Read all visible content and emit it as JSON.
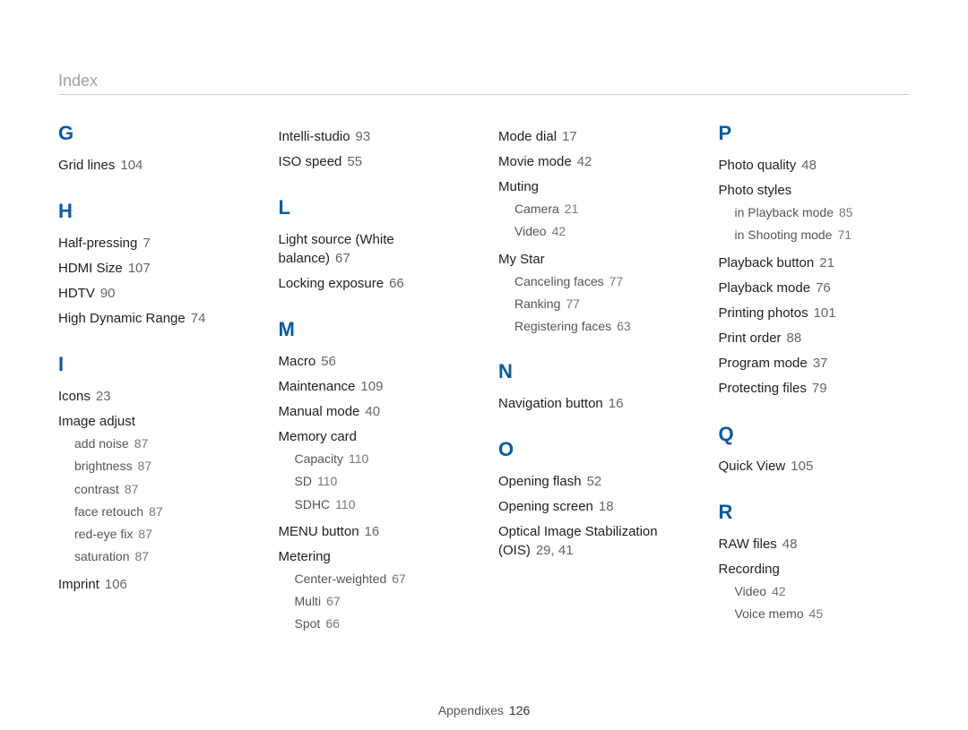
{
  "page_title": "Index",
  "footer": {
    "label": "Appendixes",
    "page": "126"
  },
  "col1": {
    "G": {
      "letter": "G",
      "items": [
        {
          "label": "Grid lines",
          "page": "104"
        }
      ]
    },
    "H": {
      "letter": "H",
      "items": [
        {
          "label": "Half-pressing",
          "page": "7"
        },
        {
          "label": "HDMI Size",
          "page": "107"
        },
        {
          "label": "HDTV",
          "page": "90"
        },
        {
          "label": "High Dynamic Range",
          "page": "74"
        }
      ]
    },
    "I": {
      "letter": "I",
      "icons": {
        "label": "Icons",
        "page": "23"
      },
      "image_adjust": {
        "label": "Image adjust",
        "subs": [
          {
            "label": "add noise",
            "page": "87"
          },
          {
            "label": "brightness",
            "page": "87"
          },
          {
            "label": "contrast",
            "page": "87"
          },
          {
            "label": "face retouch",
            "page": "87"
          },
          {
            "label": "red-eye fix",
            "page": "87"
          },
          {
            "label": "saturation",
            "page": "87"
          }
        ]
      },
      "imprint": {
        "label": "Imprint",
        "page": "106"
      }
    }
  },
  "col2": {
    "top": [
      {
        "label": "Intelli-studio",
        "page": "93"
      },
      {
        "label": "ISO speed",
        "page": "55"
      }
    ],
    "L": {
      "letter": "L",
      "items": [
        {
          "label": "Light source (White balance)",
          "page": "67"
        },
        {
          "label": "Locking exposure",
          "page": "66"
        }
      ]
    },
    "M": {
      "letter": "M",
      "items": [
        {
          "label": "Macro",
          "page": "56"
        },
        {
          "label": "Maintenance",
          "page": "109"
        },
        {
          "label": "Manual mode",
          "page": "40"
        }
      ],
      "memory": {
        "label": "Memory card",
        "subs": [
          {
            "label": "Capacity",
            "page": "110"
          },
          {
            "label": "SD",
            "page": "110"
          },
          {
            "label": "SDHC",
            "page": "110"
          }
        ]
      },
      "menu_button": {
        "label": "MENU button",
        "page": "16"
      },
      "metering": {
        "label": "Metering",
        "subs": [
          {
            "label": "Center-weighted",
            "page": "67"
          },
          {
            "label": "Multi",
            "page": "67"
          },
          {
            "label": "Spot",
            "page": "66"
          }
        ]
      }
    }
  },
  "col3": {
    "top": [
      {
        "label": "Mode dial",
        "page": "17"
      },
      {
        "label": "Movie mode",
        "page": "42"
      }
    ],
    "muting": {
      "label": "Muting",
      "subs": [
        {
          "label": "Camera",
          "page": "21"
        },
        {
          "label": "Video",
          "page": "42"
        }
      ]
    },
    "mystar": {
      "label": "My Star",
      "subs": [
        {
          "label": "Canceling faces",
          "page": "77"
        },
        {
          "label": "Ranking",
          "page": "77"
        },
        {
          "label": "Registering faces",
          "page": "63"
        }
      ]
    },
    "N": {
      "letter": "N",
      "items": [
        {
          "label": "Navigation button",
          "page": "16"
        }
      ]
    },
    "O": {
      "letter": "O",
      "items": [
        {
          "label": "Opening flash",
          "page": "52"
        },
        {
          "label": "Opening screen",
          "page": "18"
        },
        {
          "label": "Optical Image Stabilization (OIS)",
          "page": "29, 41"
        }
      ]
    }
  },
  "col4": {
    "P": {
      "letter": "P",
      "photo_quality": {
        "label": "Photo quality",
        "page": "48"
      },
      "photo_styles": {
        "label": "Photo styles",
        "subs": [
          {
            "label": "in Playback mode",
            "page": "85"
          },
          {
            "label": "in Shooting mode",
            "page": "71"
          }
        ]
      },
      "items": [
        {
          "label": "Playback button",
          "page": "21"
        },
        {
          "label": "Playback mode",
          "page": "76"
        },
        {
          "label": "Printing photos",
          "page": "101"
        },
        {
          "label": "Print order",
          "page": "88"
        },
        {
          "label": "Program mode",
          "page": "37"
        },
        {
          "label": "Protecting files",
          "page": "79"
        }
      ]
    },
    "Q": {
      "letter": "Q",
      "items": [
        {
          "label": "Quick View",
          "page": "105"
        }
      ]
    },
    "R": {
      "letter": "R",
      "raw": {
        "label": "RAW files",
        "page": "48"
      },
      "recording": {
        "label": "Recording",
        "subs": [
          {
            "label": "Video",
            "page": "42"
          },
          {
            "label": "Voice memo",
            "page": "45"
          }
        ]
      }
    }
  }
}
